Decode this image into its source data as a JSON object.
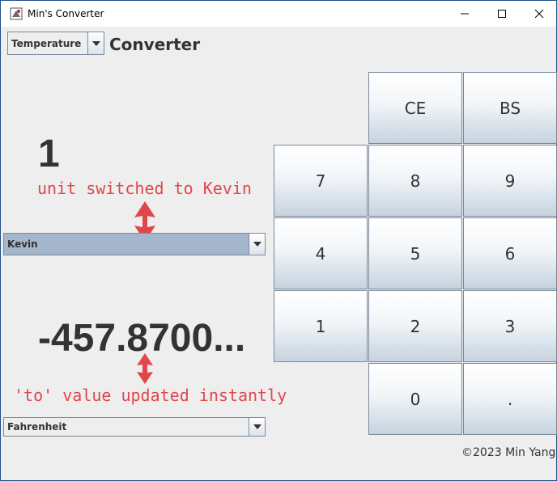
{
  "window": {
    "title": "Min's Converter",
    "controls": [
      "minimize",
      "maximize",
      "close"
    ]
  },
  "header": {
    "category_select": "Temperature",
    "title": "Converter"
  },
  "converter": {
    "from_value": "1",
    "from_unit": "Kevin",
    "to_value": "-457.8700...",
    "to_unit": "Fahrenheit"
  },
  "annotations": {
    "top": "unit switched to Kevin",
    "bottom": "'to' value updated instantly",
    "color": "#e0464c"
  },
  "keypad": {
    "ce": "CE",
    "bs": "BS",
    "k7": "7",
    "k8": "8",
    "k9": "9",
    "k4": "4",
    "k5": "5",
    "k6": "6",
    "k1": "1",
    "k2": "2",
    "k3": "3",
    "k0": "0",
    "dot": "."
  },
  "footer": {
    "copyright": "©2023 Min Yang"
  },
  "colors": {
    "background": "#eeeeee",
    "selected_combo": "#a4b6cc",
    "text": "#333333"
  }
}
